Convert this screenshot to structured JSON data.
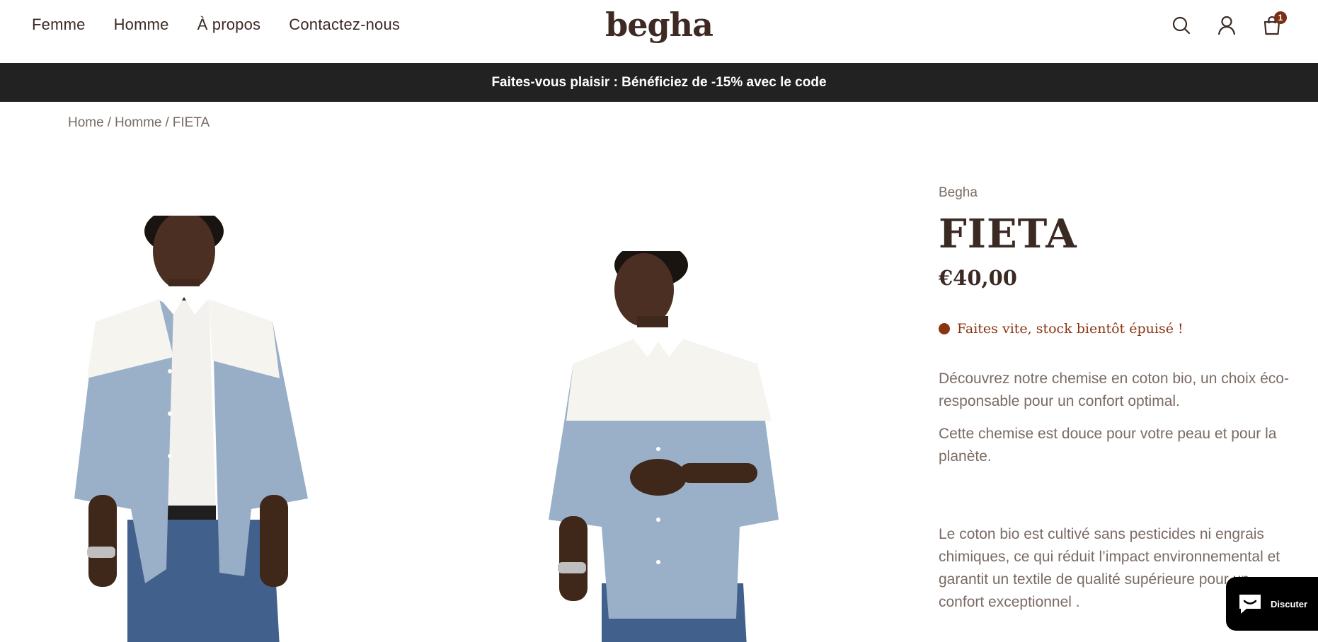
{
  "header": {
    "nav": [
      "Femme",
      "Homme",
      "À propos",
      "Contactez-nous"
    ],
    "logo": "begha",
    "cart_count": "1",
    "icons": [
      "search-icon",
      "account-icon",
      "cart-icon"
    ]
  },
  "announcement": "Faites-vous plaisir : Bénéficiez de -15% avec le code",
  "breadcrumb": [
    "Home",
    "Homme",
    "FIETA"
  ],
  "product": {
    "vendor": "Begha",
    "title": "FIETA",
    "price": "€40,00",
    "stock": "Faites vite, stock bientôt épuisé !",
    "description": [
      "Découvrez notre chemise en coton bio, un choix éco-responsable pour un confort optimal.",
      " Cette chemise est douce pour votre peau et pour la planète.",
      "Le coton bio est cultivé sans pesticides ni engrais chimiques, ce qui réduit l’impact environnemental et garantit un textile de qualité supérieure pour un confort exceptionnel ."
    ]
  },
  "chat": {
    "label": "Discuter"
  },
  "colors": {
    "accent": "#8b3410",
    "text": "#3b2a24",
    "muted": "#7a6b64",
    "announcement_bg": "#222222"
  }
}
